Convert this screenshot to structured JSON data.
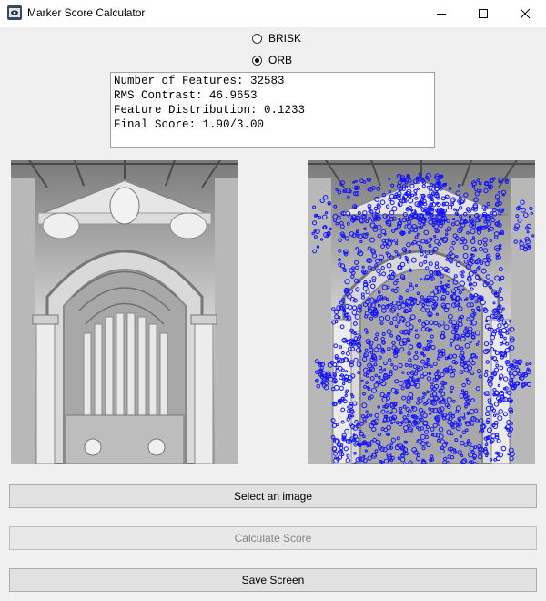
{
  "window": {
    "title": "Marker Score Calculator",
    "controls": [
      "minimize-icon",
      "maximize-icon",
      "close-icon"
    ]
  },
  "detector_options": [
    {
      "label": "BRISK",
      "selected": false
    },
    {
      "label": "ORB",
      "selected": true
    }
  ],
  "results": {
    "lines": [
      "Number of Features: 32583",
      "RMS Contrast: 46.9653",
      "Feature Distribution: 0.1233",
      "Final Score: 1.90/3.00"
    ]
  },
  "images": {
    "original": "grayscale-architecture-photo",
    "features": "feature-keypoints-overlay",
    "overlay_color": "#1414ff"
  },
  "buttons": {
    "select_image": "Select an image",
    "calculate_score": "Calculate Score",
    "save_screen": "Save Screen"
  }
}
